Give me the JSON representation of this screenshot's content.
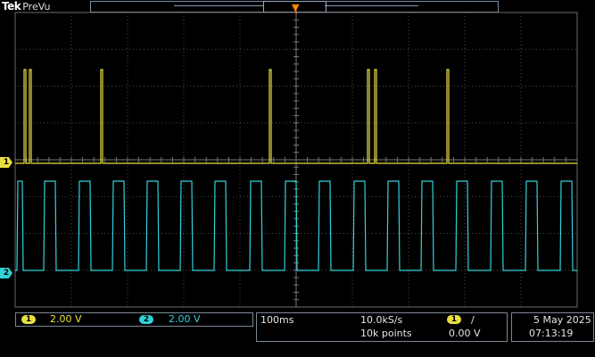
{
  "brand": {
    "logo": "Tek",
    "mode": "PreVu"
  },
  "channels": [
    {
      "id": "1",
      "color": "#e8e040",
      "scale": "2.00 V",
      "marker": "1"
    },
    {
      "id": "2",
      "color": "#31d2d9",
      "scale": "2.00 V",
      "marker": "2"
    }
  ],
  "horizontal": {
    "time_per_div": "100ms",
    "sample_rate": "10.0kS/s",
    "record_length": "10k points"
  },
  "trigger": {
    "source": "1",
    "slope": "/",
    "level": "0.00 V",
    "position_marker_color": "#ff8a00"
  },
  "datetime": {
    "date": "5 May 2025",
    "time": "07:13:19"
  },
  "colors": {
    "background": "#000000",
    "grid": "#5c5c5c",
    "border": "#7b8796"
  }
}
